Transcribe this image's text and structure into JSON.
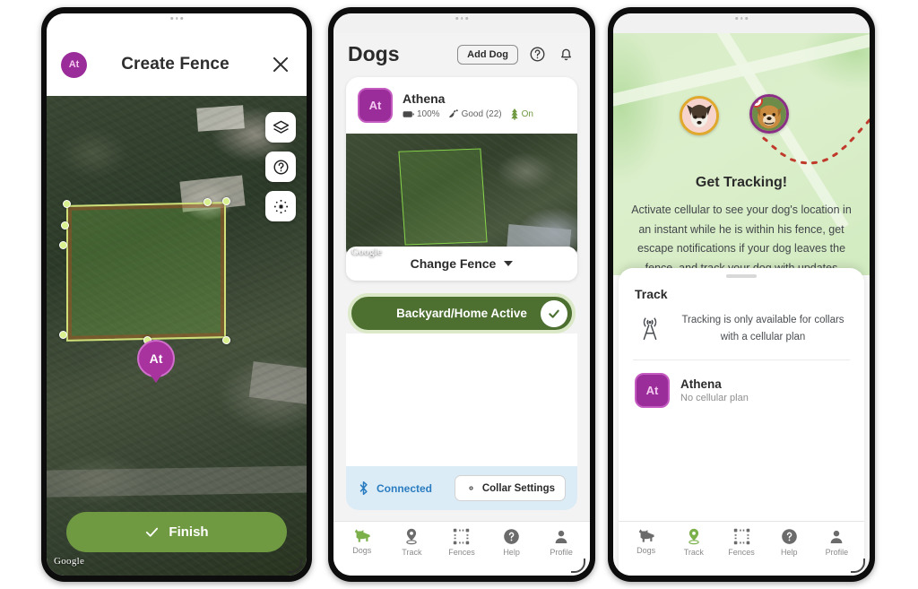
{
  "app": {
    "brand_purple": "#9b2d9b",
    "brand_green": "#6f9a42",
    "accent_blue": "#2a7cc0"
  },
  "phone1": {
    "header": {
      "avatar_initials": "At",
      "title": "Create Fence",
      "close_icon": "close-icon"
    },
    "map": {
      "attribution": "Google",
      "marker_label": "At",
      "controls": [
        {
          "name": "layers-icon",
          "label": "Map layers"
        },
        {
          "name": "help-icon",
          "label": "Help"
        },
        {
          "name": "locate-icon",
          "label": "Recenter"
        }
      ]
    },
    "finish_button": {
      "label": "Finish",
      "icon": "check-icon"
    }
  },
  "phone2": {
    "title": "Dogs",
    "add_dog_label": "Add Dog",
    "help_icon": "help-icon",
    "bell_icon": "bell-icon",
    "dog": {
      "avatar_initials": "At",
      "name": "Athena",
      "battery": "100%",
      "signal": "Good (22)",
      "status": "On"
    },
    "map_attribution": "Google",
    "change_fence_label": "Change Fence",
    "active_fence_label": "Backyard/Home Active",
    "connection_label": "Connected",
    "collar_settings_label": "Collar Settings",
    "tabs": [
      {
        "label": "Dogs",
        "icon": "dog-icon",
        "active": true
      },
      {
        "label": "Track",
        "icon": "track-pin-icon",
        "active": false
      },
      {
        "label": "Fences",
        "icon": "fence-icon",
        "active": false
      },
      {
        "label": "Help",
        "icon": "help-icon",
        "active": false
      },
      {
        "label": "Profile",
        "icon": "profile-icon",
        "active": false
      }
    ]
  },
  "phone3": {
    "promo": {
      "title": "Get Tracking!",
      "body": "Activate cellular to see your dog's location in an instant while he is within his fence, get escape notifications if your dog leaves the fence, and track your dog with updates"
    },
    "sheet": {
      "title": "Track",
      "message": "Tracking is only available for collars with a cellular plan",
      "tower_icon": "cell-tower-icon",
      "dog": {
        "avatar_initials": "At",
        "name": "Athena",
        "plan_status": "No cellular plan"
      }
    },
    "tabs": [
      {
        "label": "Dogs",
        "icon": "dog-icon",
        "active": false
      },
      {
        "label": "Track",
        "icon": "track-pin-icon",
        "active": true
      },
      {
        "label": "Fences",
        "icon": "fence-icon",
        "active": false
      },
      {
        "label": "Help",
        "icon": "help-icon",
        "active": false
      },
      {
        "label": "Profile",
        "icon": "profile-icon",
        "active": false
      }
    ]
  }
}
